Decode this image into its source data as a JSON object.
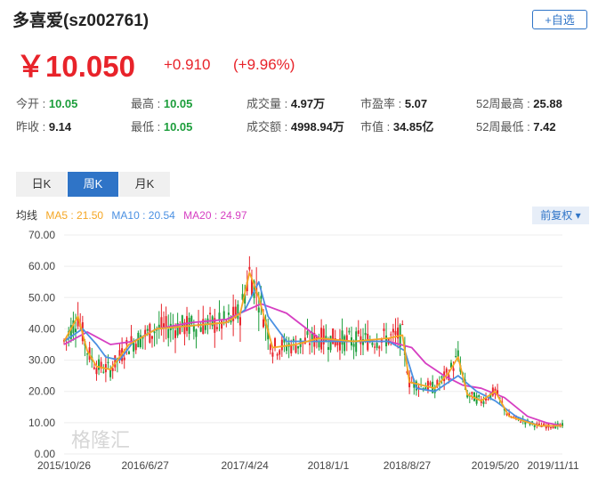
{
  "header": {
    "title": "多喜爱(sz002761)",
    "add_label": "+自选"
  },
  "quote": {
    "price": "￥10.050",
    "change": "+0.910",
    "change_pct": "(+9.96%)"
  },
  "stats": [
    {
      "label": "今开 : ",
      "value": "10.05",
      "color": "green"
    },
    {
      "label": "最高 : ",
      "value": "10.05",
      "color": "green"
    },
    {
      "label": "成交量 : ",
      "value": "4.97万",
      "color": "dark"
    },
    {
      "label": "市盈率 : ",
      "value": "5.07",
      "color": "dark"
    },
    {
      "label": "52周最高 : ",
      "value": "25.88",
      "color": "dark"
    },
    {
      "label": "昨收 : ",
      "value": "9.14",
      "color": "dark"
    },
    {
      "label": "最低 : ",
      "value": "10.05",
      "color": "green"
    },
    {
      "label": "成交额 : ",
      "value": "4998.94万",
      "color": "dark"
    },
    {
      "label": "市值 : ",
      "value": "34.85亿",
      "color": "dark"
    },
    {
      "label": "52周最低 : ",
      "value": "7.42",
      "color": "dark"
    }
  ],
  "tabs": [
    {
      "label": "日K",
      "active": false
    },
    {
      "label": "周K",
      "active": true
    },
    {
      "label": "月K",
      "active": false
    }
  ],
  "legend": {
    "label": "均线",
    "ma5": "MA5 : 21.50",
    "ma10": "MA10 : 20.54",
    "ma20": "MA20 : 24.97"
  },
  "adjust_label": "前复权",
  "watermark": "格隆汇",
  "colors": {
    "up": "#e8232a",
    "down": "#1d9e3c",
    "accent": "#2f74c7",
    "ma5": "#f5a623",
    "ma10": "#4a90e2",
    "ma20": "#d63fc2"
  },
  "chart_data": {
    "type": "line",
    "title": "",
    "xlabel": "",
    "ylabel": "",
    "ylim": [
      0,
      70
    ],
    "yticks": [
      "0.00",
      "10.00",
      "20.00",
      "30.00",
      "40.00",
      "50.00",
      "60.00",
      "70.00"
    ],
    "xticks": [
      {
        "label": "2015/10/26",
        "x": 0
      },
      {
        "label": "2016/6/27",
        "x": 35
      },
      {
        "label": "2017/4/24",
        "x": 78
      },
      {
        "label": "2018/1/1",
        "x": 114
      },
      {
        "label": "2018/8/27",
        "x": 148
      },
      {
        "label": "2019/5/20",
        "x": 186
      },
      {
        "label": "2019/11/11",
        "x": 211
      }
    ],
    "series": [
      {
        "name": "MA20",
        "values": [
          [
            0,
            35
          ],
          [
            10,
            39
          ],
          [
            20,
            35
          ],
          [
            30,
            36
          ],
          [
            40,
            40
          ],
          [
            55,
            42
          ],
          [
            70,
            43
          ],
          [
            85,
            48
          ],
          [
            96,
            45
          ],
          [
            110,
            37
          ],
          [
            120,
            36
          ],
          [
            130,
            36
          ],
          [
            140,
            36
          ],
          [
            150,
            34
          ],
          [
            156,
            29
          ],
          [
            164,
            25
          ],
          [
            172,
            22
          ],
          [
            180,
            21
          ],
          [
            190,
            18
          ],
          [
            200,
            12
          ],
          [
            208,
            10
          ],
          [
            215,
            9
          ]
        ]
      },
      {
        "name": "MA10",
        "values": [
          [
            0,
            36
          ],
          [
            8,
            40
          ],
          [
            14,
            35
          ],
          [
            18,
            31
          ],
          [
            24,
            30
          ],
          [
            30,
            36
          ],
          [
            40,
            40
          ],
          [
            55,
            41
          ],
          [
            70,
            42
          ],
          [
            78,
            46
          ],
          [
            84,
            55
          ],
          [
            88,
            44
          ],
          [
            96,
            36
          ],
          [
            110,
            36
          ],
          [
            125,
            36
          ],
          [
            140,
            36
          ],
          [
            147,
            33
          ],
          [
            152,
            21
          ],
          [
            160,
            20
          ],
          [
            170,
            25
          ],
          [
            178,
            20
          ],
          [
            186,
            17
          ],
          [
            195,
            12
          ],
          [
            205,
            9
          ],
          [
            215,
            9
          ]
        ]
      },
      {
        "name": "MA5",
        "values": [
          [
            0,
            36
          ],
          [
            6,
            44
          ],
          [
            10,
            33
          ],
          [
            14,
            28
          ],
          [
            20,
            27
          ],
          [
            28,
            35
          ],
          [
            40,
            40
          ],
          [
            55,
            41
          ],
          [
            70,
            42
          ],
          [
            76,
            45
          ],
          [
            80,
            58
          ],
          [
            84,
            50
          ],
          [
            90,
            34
          ],
          [
            100,
            35
          ],
          [
            110,
            37
          ],
          [
            125,
            36
          ],
          [
            140,
            37
          ],
          [
            146,
            38
          ],
          [
            149,
            23
          ],
          [
            160,
            21
          ],
          [
            166,
            26
          ],
          [
            170,
            31
          ],
          [
            174,
            19
          ],
          [
            180,
            17
          ],
          [
            186,
            20
          ],
          [
            192,
            12
          ],
          [
            205,
            9
          ],
          [
            215,
            9
          ]
        ]
      }
    ],
    "candles_summary": "weekly candlestick bars rendered along the MA paths"
  }
}
